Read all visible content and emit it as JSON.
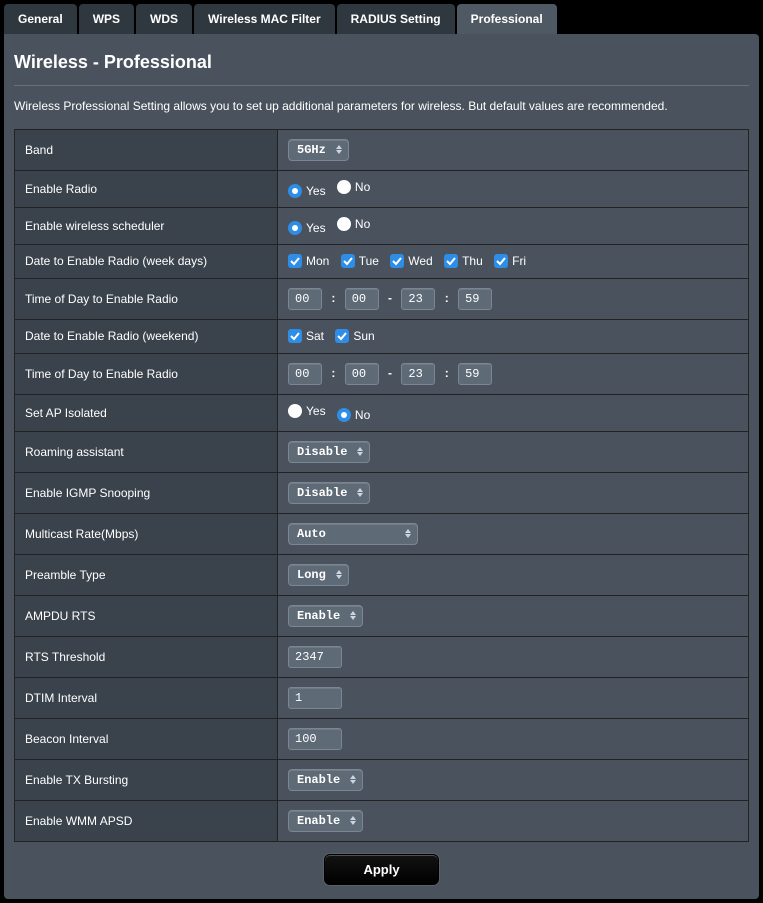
{
  "tabs": {
    "general": "General",
    "wps": "WPS",
    "wds": "WDS",
    "macfilter": "Wireless MAC Filter",
    "radius": "RADIUS Setting",
    "professional": "Professional"
  },
  "page": {
    "title": "Wireless - Professional",
    "description": "Wireless Professional Setting allows you to set up additional parameters for wireless. But default values are recommended."
  },
  "labels": {
    "band": "Band",
    "enable_radio": "Enable Radio",
    "enable_scheduler": "Enable wireless scheduler",
    "date_week": "Date to Enable Radio (week days)",
    "time_week": "Time of Day to Enable Radio",
    "date_weekend": "Date to Enable Radio (weekend)",
    "time_weekend": "Time of Day to Enable Radio",
    "ap_isolated": "Set AP Isolated",
    "roaming": "Roaming assistant",
    "igmp": "Enable IGMP Snooping",
    "multicast": "Multicast Rate(Mbps)",
    "preamble": "Preamble Type",
    "ampdu": "AMPDU RTS",
    "rts": "RTS Threshold",
    "dtim": "DTIM Interval",
    "beacon": "Beacon Interval",
    "txburst": "Enable TX Bursting",
    "wmm": "Enable WMM APSD"
  },
  "options": {
    "yes": "Yes",
    "no": "No",
    "mon": "Mon",
    "tue": "Tue",
    "wed": "Wed",
    "thu": "Thu",
    "fri": "Fri",
    "sat": "Sat",
    "sun": "Sun"
  },
  "values": {
    "band": "5GHz",
    "enable_radio": "Yes",
    "enable_scheduler": "Yes",
    "week_days": {
      "mon": true,
      "tue": true,
      "wed": true,
      "thu": true,
      "fri": true
    },
    "time_week": {
      "h1": "00",
      "m1": "00",
      "h2": "23",
      "m2": "59"
    },
    "weekend_days": {
      "sat": true,
      "sun": true
    },
    "time_weekend": {
      "h1": "00",
      "m1": "00",
      "h2": "23",
      "m2": "59"
    },
    "ap_isolated": "No",
    "roaming": "Disable",
    "igmp": "Disable",
    "multicast": "Auto",
    "preamble": "Long",
    "ampdu": "Enable",
    "rts": "2347",
    "dtim": "1",
    "beacon": "100",
    "txburst": "Enable",
    "wmm": "Enable"
  },
  "buttons": {
    "apply": "Apply"
  }
}
